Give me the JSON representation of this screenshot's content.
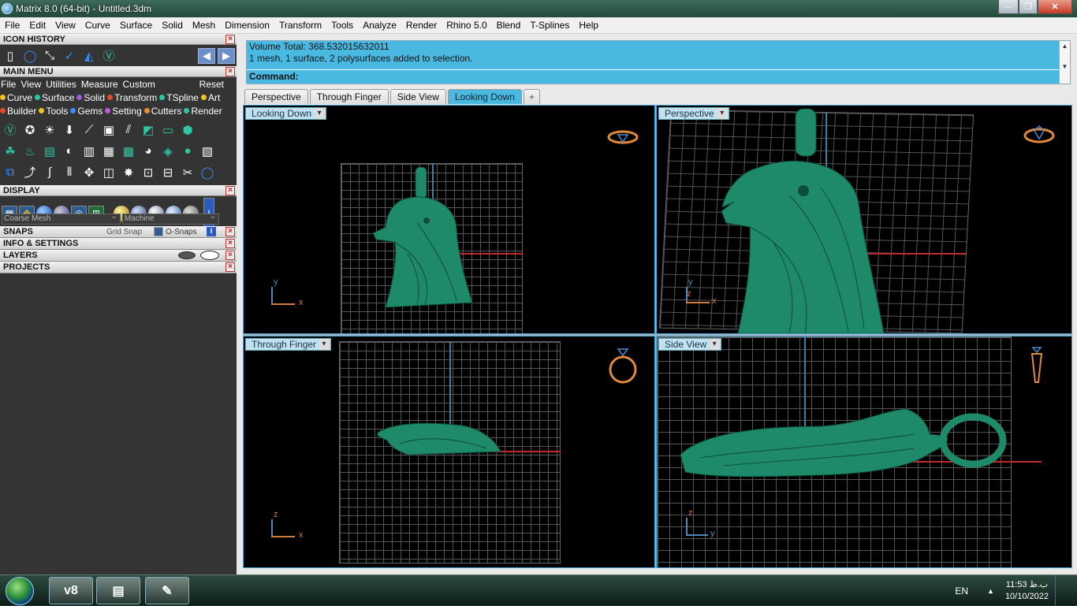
{
  "window": {
    "title": "Matrix 8.0 (64-bit) - Untitled.3dm",
    "min_symbol": "—",
    "max_symbol": "❐",
    "close_symbol": "✕"
  },
  "menubar": [
    "File",
    "Edit",
    "View",
    "Curve",
    "Surface",
    "Solid",
    "Mesh",
    "Dimension",
    "Transform",
    "Tools",
    "Analyze",
    "Render",
    "Rhino 5.0",
    "Blend",
    "T-Splines",
    "Help"
  ],
  "left": {
    "icon_history": "ICON HISTORY",
    "main_menu": "MAIN MENU",
    "mm_items": [
      "File",
      "View",
      "Utilities",
      "Measure",
      "Custom"
    ],
    "mm_reset": "Reset",
    "cat_row1": [
      {
        "label": "Curve",
        "color": "#f0c419"
      },
      {
        "label": "Surface",
        "color": "#2ec4a5"
      },
      {
        "label": "Solid",
        "color": "#a05be0"
      },
      {
        "label": "Transform",
        "color": "#e24a2e"
      },
      {
        "label": "TSpline",
        "color": "#2ec4a5"
      },
      {
        "label": "Art",
        "color": "#f0c419"
      }
    ],
    "cat_row2": [
      {
        "label": "Builder",
        "color": "#e24a2e"
      },
      {
        "label": "Tools",
        "color": "#f0c419"
      },
      {
        "label": "Gems",
        "color": "#3b8cff"
      },
      {
        "label": "Setting",
        "color": "#c45be0"
      },
      {
        "label": "Cutters",
        "color": "#f08a2e"
      },
      {
        "label": "Render",
        "color": "#2ec4a5"
      }
    ],
    "display": "DISPLAY",
    "mesh_select": "Coarse Mesh",
    "material_select": "Machine",
    "snaps": "SNAPS",
    "grid_snap": "Grid Snap",
    "o_snaps": "O-Snaps",
    "info_settings": "INFO & SETTINGS",
    "layers": "LAYERS",
    "projects": "PROJECTS"
  },
  "command": {
    "line1": "Volume Total: 368.532015632011",
    "line2": "1 mesh, 1 surface, 2 polysurfaces added to selection.",
    "prompt": "Command:"
  },
  "tabs": [
    "Perspective",
    "Through Finger",
    "Side View",
    "Looking Down"
  ],
  "active_tab": "Looking Down",
  "tab_add": "+",
  "viewports": {
    "top_left": {
      "label": "Looking Down",
      "axis_v": "y",
      "axis_h": "x"
    },
    "top_right": {
      "label": "Perspective",
      "axis_v": "y",
      "axis_h": "x",
      "axis_z": "z"
    },
    "bottom_left": {
      "label": "Through Finger",
      "axis_v": "z",
      "axis_h": "x"
    },
    "bottom_right": {
      "label": "Side View",
      "axis_v": "z",
      "axis_h": "y"
    }
  },
  "taskbar": {
    "matrix_app": "v8",
    "language": "EN",
    "time": "11:53 ب.ظ",
    "date": "10/10/2022"
  },
  "colors": {
    "model": "#1e8a6a",
    "accent": "#49b9e1",
    "axis_x": "#c0282a",
    "axis_y": "#3a7fa8"
  }
}
